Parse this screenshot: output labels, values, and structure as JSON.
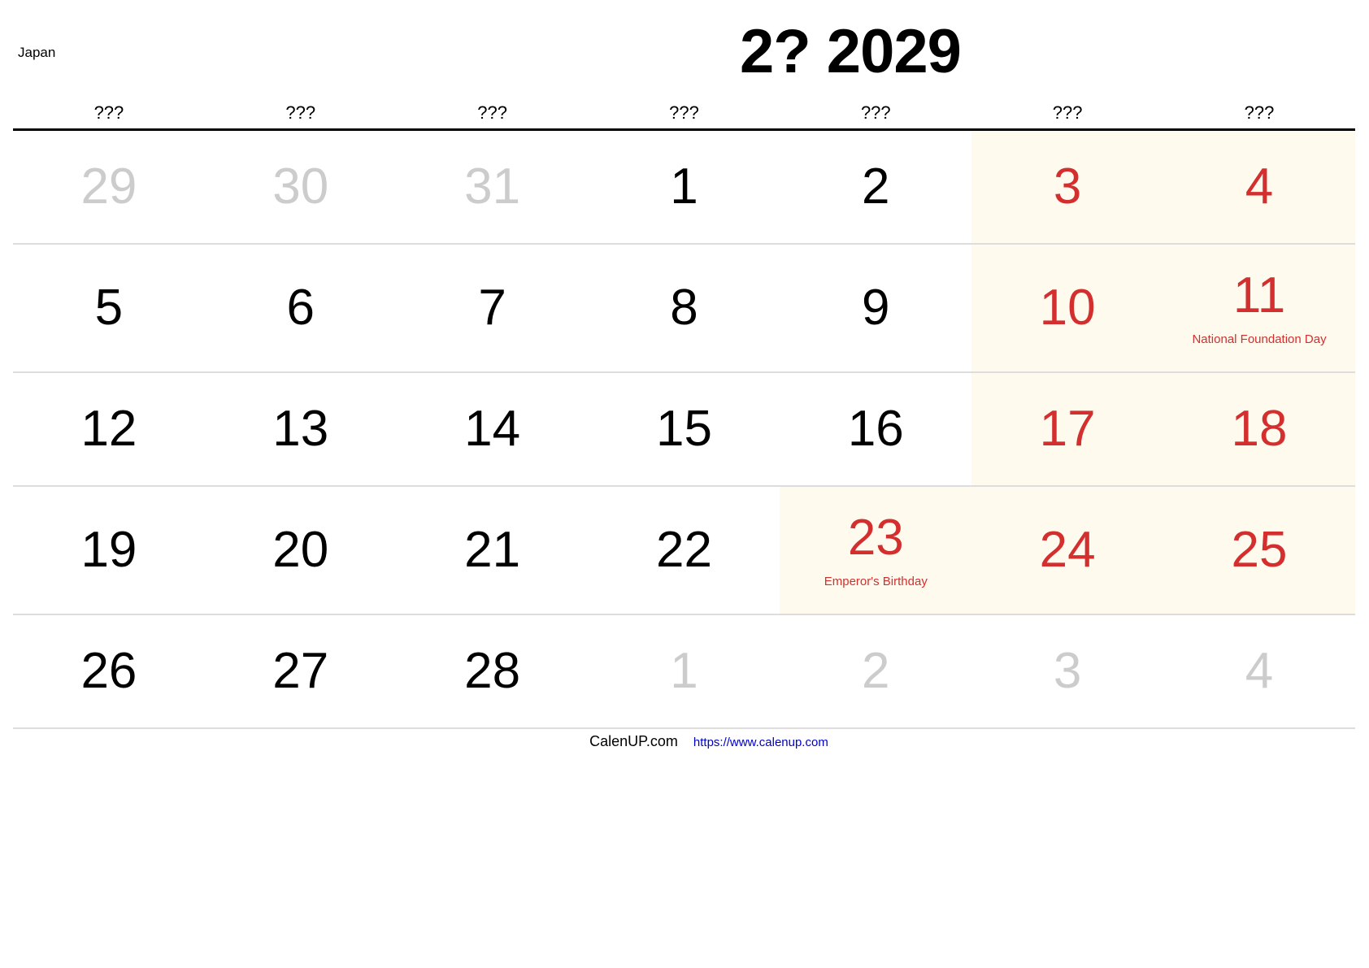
{
  "header": {
    "country": "Japan",
    "title": "2? 2029"
  },
  "weekdays": [
    "???",
    "???",
    "???",
    "???",
    "???",
    "???",
    "???"
  ],
  "weeks": [
    [
      {
        "day": "29",
        "type": "other",
        "holiday": ""
      },
      {
        "day": "30",
        "type": "other",
        "holiday": ""
      },
      {
        "day": "31",
        "type": "other",
        "holiday": ""
      },
      {
        "day": "1",
        "type": "normal",
        "holiday": ""
      },
      {
        "day": "2",
        "type": "normal",
        "holiday": ""
      },
      {
        "day": "3",
        "type": "weekend",
        "holiday": ""
      },
      {
        "day": "4",
        "type": "weekend",
        "holiday": ""
      }
    ],
    [
      {
        "day": "5",
        "type": "normal",
        "holiday": ""
      },
      {
        "day": "6",
        "type": "normal",
        "holiday": ""
      },
      {
        "day": "7",
        "type": "normal",
        "holiday": ""
      },
      {
        "day": "8",
        "type": "normal",
        "holiday": ""
      },
      {
        "day": "9",
        "type": "normal",
        "holiday": ""
      },
      {
        "day": "10",
        "type": "weekend",
        "holiday": ""
      },
      {
        "day": "11",
        "type": "weekend",
        "holiday": "National Foundation Day"
      }
    ],
    [
      {
        "day": "12",
        "type": "normal",
        "holiday": ""
      },
      {
        "day": "13",
        "type": "normal",
        "holiday": ""
      },
      {
        "day": "14",
        "type": "normal",
        "holiday": ""
      },
      {
        "day": "15",
        "type": "normal",
        "holiday": ""
      },
      {
        "day": "16",
        "type": "normal",
        "holiday": ""
      },
      {
        "day": "17",
        "type": "weekend",
        "holiday": ""
      },
      {
        "day": "18",
        "type": "weekend",
        "holiday": ""
      }
    ],
    [
      {
        "day": "19",
        "type": "normal",
        "holiday": ""
      },
      {
        "day": "20",
        "type": "normal",
        "holiday": ""
      },
      {
        "day": "21",
        "type": "normal",
        "holiday": ""
      },
      {
        "day": "22",
        "type": "normal",
        "holiday": ""
      },
      {
        "day": "23",
        "type": "holiday",
        "holiday": "Emperor's Birthday"
      },
      {
        "day": "24",
        "type": "weekend",
        "holiday": ""
      },
      {
        "day": "25",
        "type": "weekend",
        "holiday": ""
      }
    ],
    [
      {
        "day": "26",
        "type": "normal",
        "holiday": ""
      },
      {
        "day": "27",
        "type": "normal",
        "holiday": ""
      },
      {
        "day": "28",
        "type": "normal",
        "holiday": ""
      },
      {
        "day": "1",
        "type": "other",
        "holiday": ""
      },
      {
        "day": "2",
        "type": "other",
        "holiday": ""
      },
      {
        "day": "3",
        "type": "other",
        "holiday": ""
      },
      {
        "day": "4",
        "type": "other",
        "holiday": ""
      }
    ]
  ],
  "footer": {
    "brand": "CalenUP.com",
    "url": "https://www.calenup.com"
  },
  "colors": {
    "holiday_red": "#d32f2f",
    "weekend_bg": "#fffaee",
    "other_month_gray": "#cccccc",
    "link_blue": "#0000cc"
  }
}
